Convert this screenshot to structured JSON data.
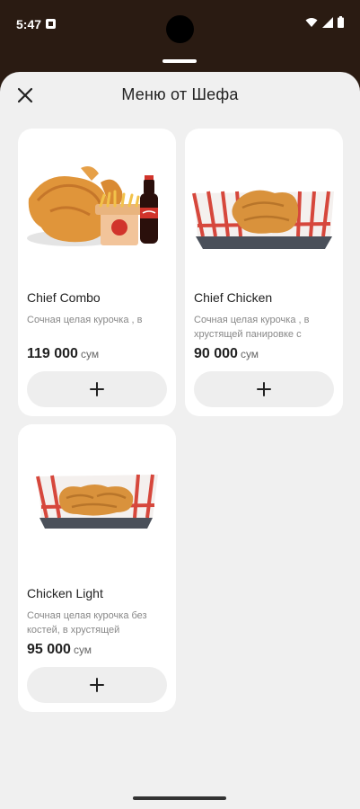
{
  "status_bar": {
    "time": "5:47"
  },
  "sheet": {
    "title": "Меню от Шефа"
  },
  "products": [
    {
      "name": "Chief Combo",
      "description": "Сочная целая курочка , в",
      "price": "119 000",
      "currency": "сум"
    },
    {
      "name": "Chief Chicken",
      "description": "Сочная целая курочка , в хрустящей панировке с",
      "price": "90 000",
      "currency": "сум"
    },
    {
      "name": "Chicken Light",
      "description": "Сочная целая курочка без костей, в хрустящей",
      "price": "95 000",
      "currency": "сум"
    }
  ],
  "icons": {
    "close": "close-icon",
    "add": "plus-icon"
  },
  "colors": {
    "status_bar_bg": "#2a1b12",
    "sheet_bg": "#f0f0f0",
    "card_bg": "#ffffff",
    "add_button_bg": "#eeeeee"
  }
}
